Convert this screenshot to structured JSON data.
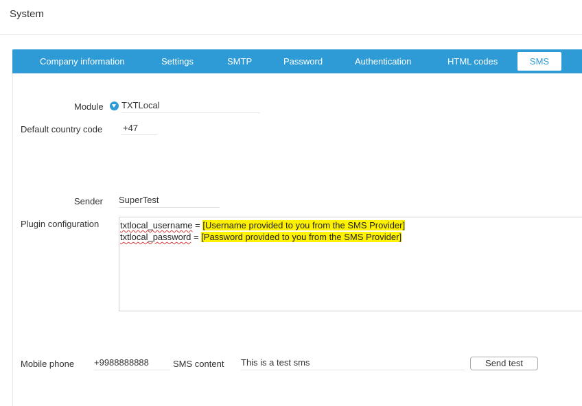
{
  "page": {
    "title": "System"
  },
  "tabs": [
    {
      "label": "Company information",
      "active": false
    },
    {
      "label": "Settings",
      "active": false
    },
    {
      "label": "SMTP",
      "active": false
    },
    {
      "label": "Password",
      "active": false
    },
    {
      "label": "Authentication",
      "active": false
    },
    {
      "label": "HTML codes",
      "active": false
    },
    {
      "label": "SMS",
      "active": true
    }
  ],
  "form": {
    "module": {
      "label": "Module",
      "value": "TXTLocal",
      "icon": "chevron-down-icon"
    },
    "country_code": {
      "label": "Default country code",
      "value": "+47"
    },
    "sender": {
      "label": "Sender",
      "value": "SuperTest"
    },
    "plugin_config": {
      "label": "Plugin configuration",
      "lines": [
        {
          "key": "txtlocal_username",
          "equals": " = ",
          "value": "[Username provided to you from the SMS Provider]"
        },
        {
          "key": "txtlocal_password",
          "equals": " = ",
          "value": "[Password provided to you from the SMS Provider]"
        }
      ]
    },
    "mobile_phone": {
      "label": "Mobile phone",
      "value": "+9988888888"
    },
    "sms_content": {
      "label": "SMS content",
      "value": "This is a test sms"
    },
    "send_test_button": "Send test"
  },
  "colors": {
    "accent": "#2f9bd6",
    "highlight": "#fff200",
    "spellcheck": "#d93a3a"
  }
}
